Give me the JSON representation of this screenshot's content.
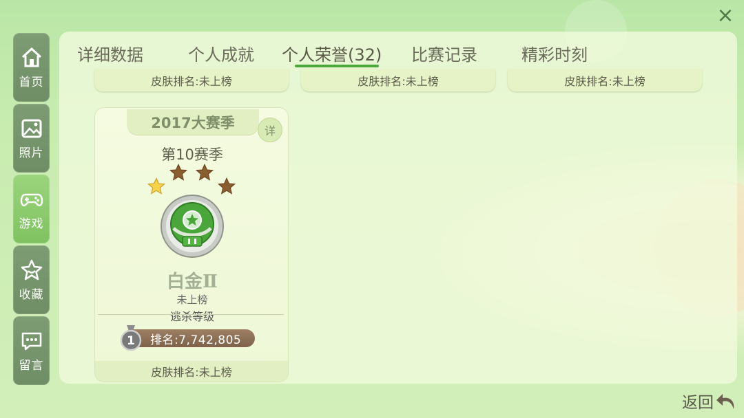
{
  "close_label": "×",
  "sidebar": {
    "items": [
      {
        "label": "首页",
        "icon": "home-icon",
        "active": false
      },
      {
        "label": "照片",
        "icon": "photo-icon",
        "active": false
      },
      {
        "label": "游戏",
        "icon": "gamepad-icon",
        "active": true
      },
      {
        "label": "收藏",
        "icon": "star-icon",
        "active": false
      },
      {
        "label": "留言",
        "icon": "message-icon",
        "active": false
      }
    ]
  },
  "tabs": [
    {
      "label": "详细数据"
    },
    {
      "label": "个人成就"
    },
    {
      "label": "个人荣誉(32)"
    },
    {
      "label": "比赛记录"
    },
    {
      "label": "精彩时刻"
    }
  ],
  "active_tab": "个人荣誉(32)",
  "top_strips": [
    {
      "label": "皮肤排名:未上榜"
    },
    {
      "label": "皮肤排名:未上榜"
    },
    {
      "label": "皮肤排名:未上榜"
    }
  ],
  "card": {
    "season_banner": "2017大赛季",
    "detail_label": "详",
    "season_title": "第10赛季",
    "stars_filled": 3,
    "stars_total": 4,
    "rank_name": "白金Ⅱ",
    "rank_status": "未上榜",
    "rank_type": "逃杀等级",
    "rank_medal_number": "1",
    "rank_position": "排名:7,742,805",
    "footer": "皮肤排名:未上榜"
  },
  "back_label": "返回",
  "colors": {
    "accent_green": "#4ca63c",
    "sidebar_active": "#80c262",
    "sidebar_inactive": "#6f8e65",
    "star_gold": "#f5d24a",
    "star_bronze": "#8a5e2f"
  }
}
